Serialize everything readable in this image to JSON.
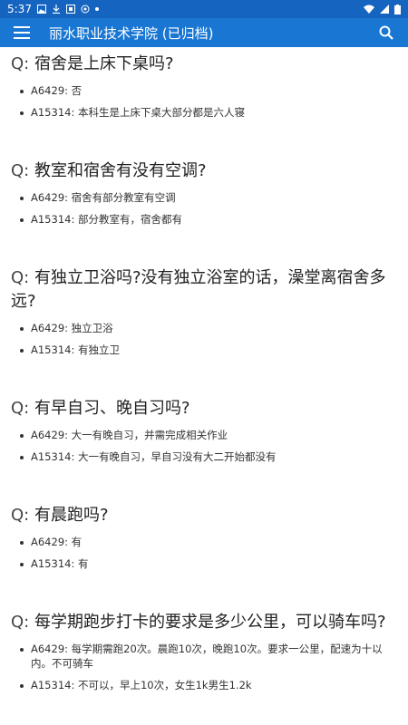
{
  "status_bar": {
    "time": "5:37",
    "indicators": [
      "image-icon",
      "download-icon",
      "notification-icon",
      "app-icon",
      "dot"
    ],
    "right_icons": [
      "wifi-icon",
      "signal-icon",
      "battery-icon"
    ]
  },
  "app_bar": {
    "title": "丽水职业技术学院 (已归档)",
    "menu_icon": "menu-icon",
    "search_icon": "search-icon"
  },
  "questions": [
    {
      "q_prefix": "Q:",
      "text": "宿舍是上床下桌吗?",
      "answers": [
        {
          "user": "A6429:",
          "text": "否"
        },
        {
          "user": "A15314:",
          "text": "本科生是上床下桌大部分都是六人寝"
        }
      ]
    },
    {
      "q_prefix": "Q:",
      "text": "教室和宿舍有没有空调?",
      "answers": [
        {
          "user": "A6429:",
          "text": "宿舍有部分教室有空调"
        },
        {
          "user": "A15314:",
          "text": "部分教室有，宿舍都有"
        }
      ]
    },
    {
      "q_prefix": "Q:",
      "text": "有独立卫浴吗?没有独立浴室的话，澡堂离宿舍多远?",
      "answers": [
        {
          "user": "A6429:",
          "text": "独立卫浴"
        },
        {
          "user": "A15314:",
          "text": "有独立卫"
        }
      ]
    },
    {
      "q_prefix": "Q:",
      "text": "有早自习、晚自习吗?",
      "answers": [
        {
          "user": "A6429:",
          "text": "大一有晚自习，并需完成相关作业"
        },
        {
          "user": "A15314:",
          "text": "大一有晚自习，早自习没有大二开始都没有"
        }
      ]
    },
    {
      "q_prefix": "Q:",
      "text": "有晨跑吗?",
      "answers": [
        {
          "user": "A6429:",
          "text": "有"
        },
        {
          "user": "A15314:",
          "text": "有"
        }
      ]
    },
    {
      "q_prefix": "Q:",
      "text": "每学期跑步打卡的要求是多少公里，可以骑车吗?",
      "answers": [
        {
          "user": "A6429:",
          "text": "每学期需跑20次。晨跑10次，晚跑10次。要求一公里，配速为十以内。不可骑车"
        },
        {
          "user": "A15314:",
          "text": "不可以，早上10次，女生1k男生1.2k"
        }
      ]
    }
  ]
}
